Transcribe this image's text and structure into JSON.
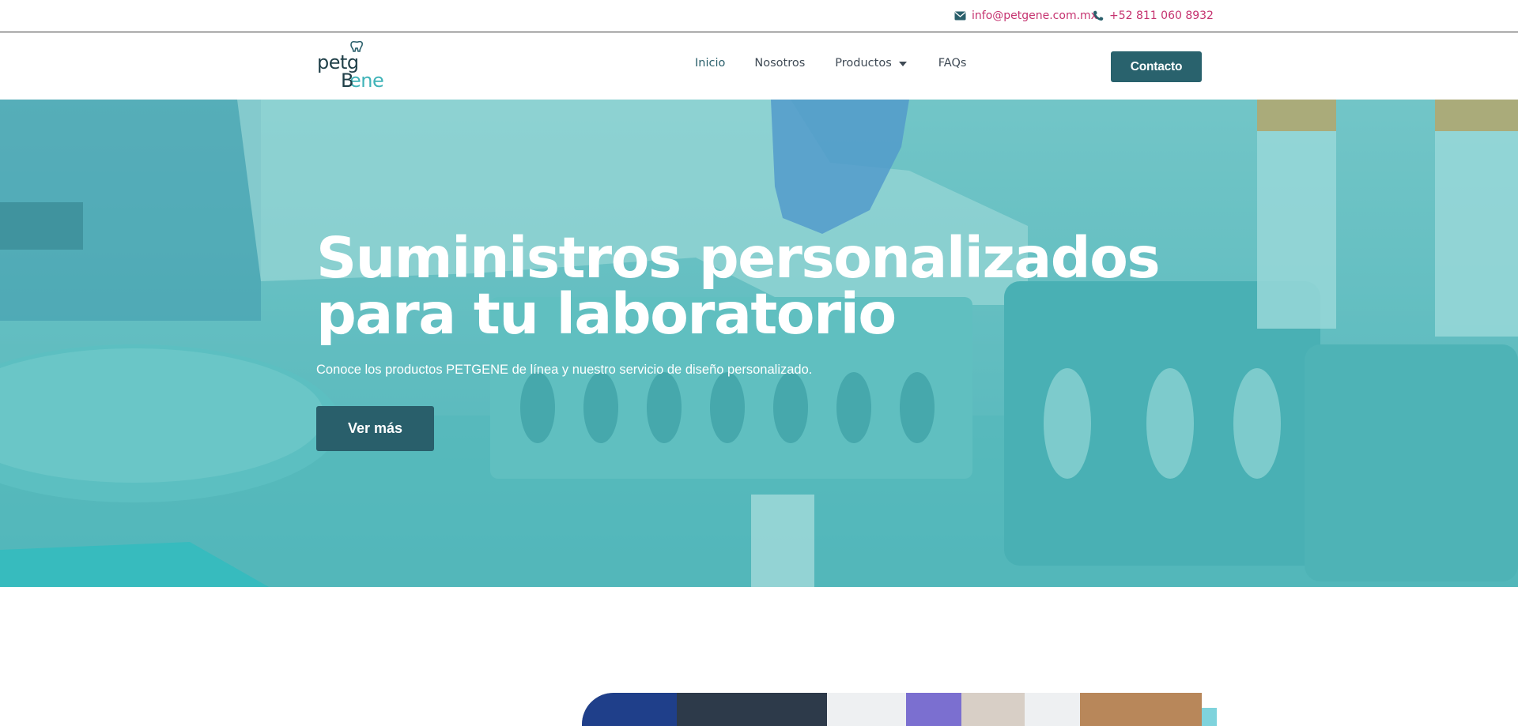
{
  "topbar": {
    "email": "info@petgene.com.mx",
    "phone": "+52 811 060 8932",
    "email_icon": "envelope-icon",
    "phone_icon": "phone-icon"
  },
  "nav": {
    "logo_text_top": "petg",
    "logo_text_bottom": "ene",
    "logo_letter": "B",
    "items": [
      {
        "label": "Inicio"
      },
      {
        "label": "Nosotros"
      },
      {
        "label": "Productos"
      },
      {
        "label": "FAQs"
      }
    ],
    "contact_label": "Contacto"
  },
  "hero": {
    "title": "Suministros personalizados para tu laboratorio",
    "subtitle": "Conoce los productos PETGENE de línea y nuestro servicio de diseño personalizado.",
    "button_label": "Ver más"
  },
  "colors": {
    "accent": "#c5326f",
    "brand_dark": "#29626d",
    "teal_overlay": "#4fb5b8"
  }
}
